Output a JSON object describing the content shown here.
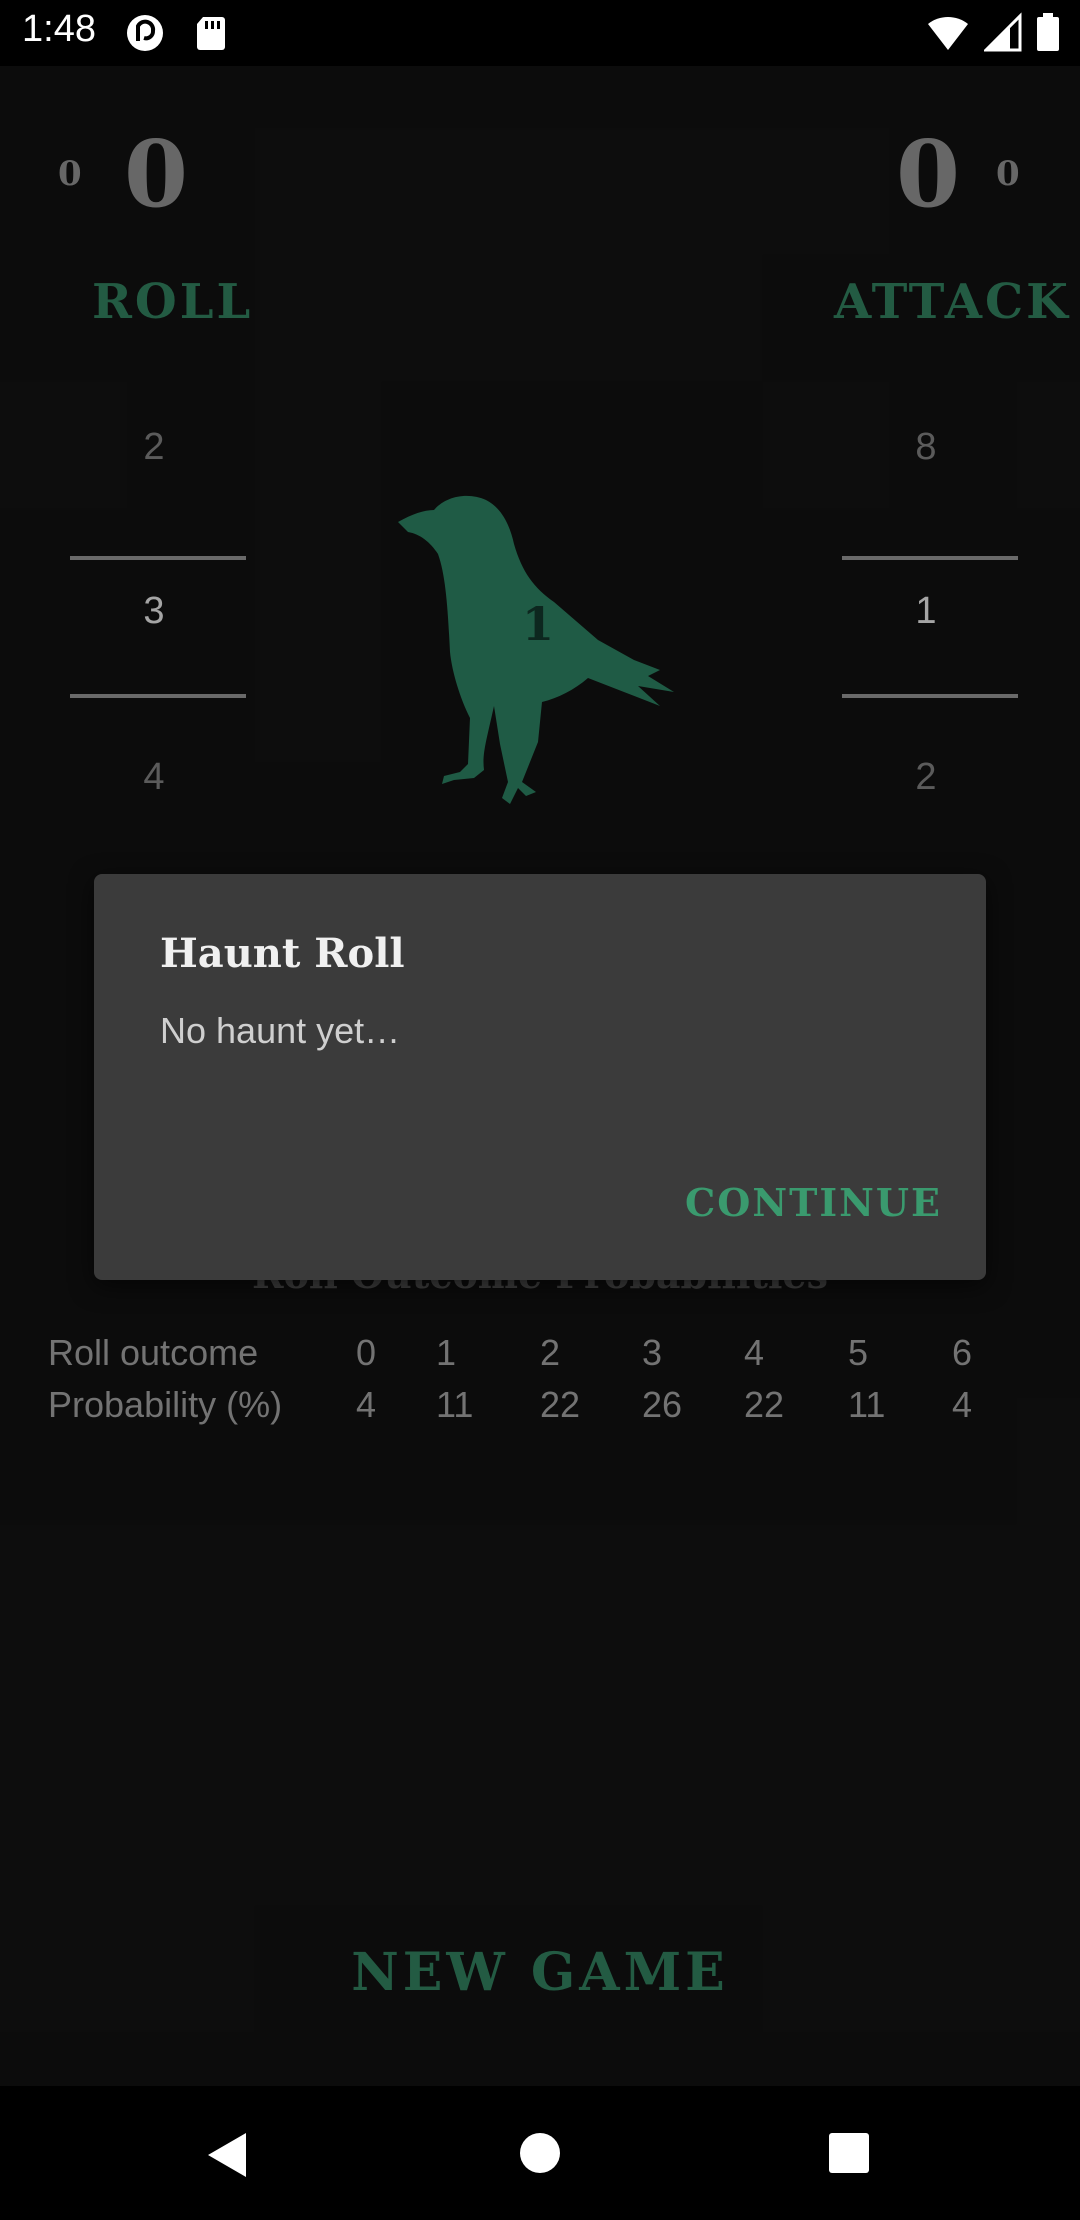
{
  "status_bar": {
    "time": "1:48",
    "left_icons": [
      "pocket-casts-icon",
      "sd-card-icon"
    ],
    "right_icons": [
      "wifi-icon",
      "signal-icon",
      "battery-icon"
    ]
  },
  "scores": {
    "left_small": "0",
    "left_big": "0",
    "right_big": "0",
    "right_small": "0"
  },
  "buttons": {
    "roll": "ROLL",
    "attack": "ATTACK",
    "new_game": "NEW GAME"
  },
  "roll_picker": {
    "above": "2",
    "selected": "3",
    "below": "4"
  },
  "attack_picker": {
    "above": "8",
    "selected": "1",
    "below": "2"
  },
  "raven": {
    "number": "1",
    "color": "#2a7a5c"
  },
  "probabilities": {
    "title": "Roll Outcome Probabilities",
    "row1_label": "Roll outcome",
    "row2_label": "Probability (%)",
    "outcomes": [
      "0",
      "1",
      "2",
      "3",
      "4",
      "5",
      "6"
    ],
    "percentages": [
      "4",
      "11",
      "22",
      "26",
      "22",
      "11",
      "4"
    ]
  },
  "dialog": {
    "title": "Haunt Roll",
    "message": "No haunt yet…",
    "button": "CONTINUE"
  },
  "colors": {
    "accent": "#2f7a5a",
    "dialog_button": "#3a9a6e",
    "background": "#111111",
    "dialog_background": "#3b3b3b"
  },
  "nav_bar": {
    "icons": [
      "back-icon",
      "home-icon",
      "recents-icon"
    ]
  }
}
